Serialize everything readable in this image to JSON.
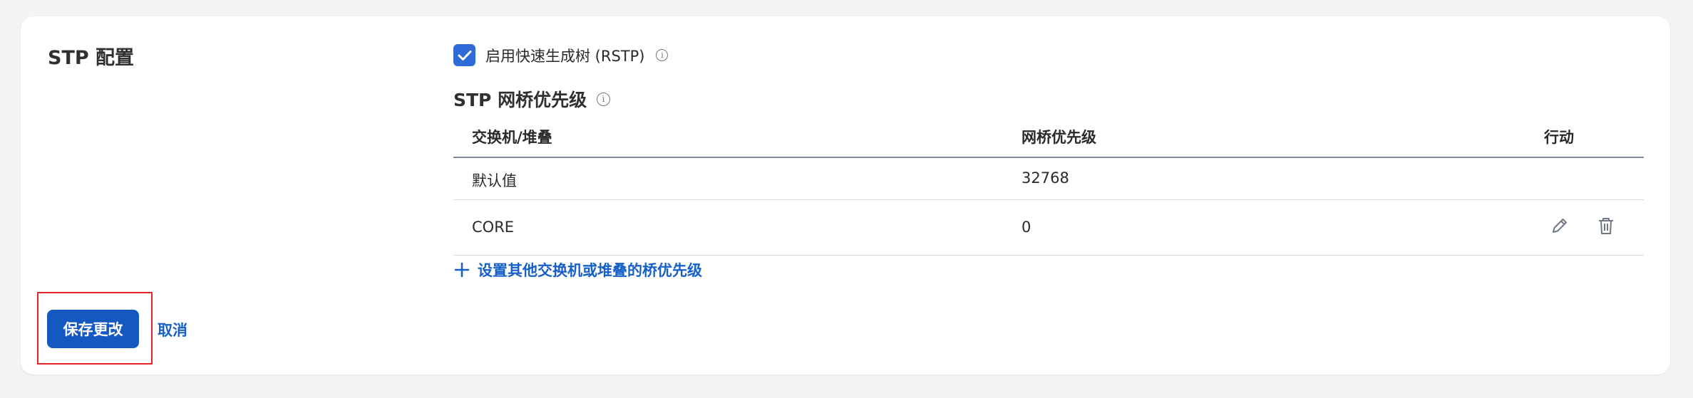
{
  "section_title": "STP 配置",
  "rstp": {
    "label": "启用快速生成树 (RSTP)",
    "checked": true,
    "info_icon": "info-icon"
  },
  "bridge_priority": {
    "title": "STP 网桥优先级",
    "info_icon": "info-icon",
    "columns": [
      "交换机/堆叠",
      "网桥优先级",
      "行动"
    ],
    "rows": [
      {
        "switch": "默认值",
        "priority": "32768",
        "actions": []
      },
      {
        "switch": "CORE",
        "priority": "0",
        "actions": [
          "pencil-edit-icon",
          "trash-delete-icon"
        ]
      }
    ],
    "add_link": "设置其他交换机或堆叠的桥优先级"
  },
  "actions": {
    "save": "保存更改",
    "cancel": "取消"
  },
  "colors": {
    "primary": "#1458c2",
    "link": "#1660c7",
    "checkbox": "#2f6bd8",
    "highlight": "#e4232b"
  }
}
